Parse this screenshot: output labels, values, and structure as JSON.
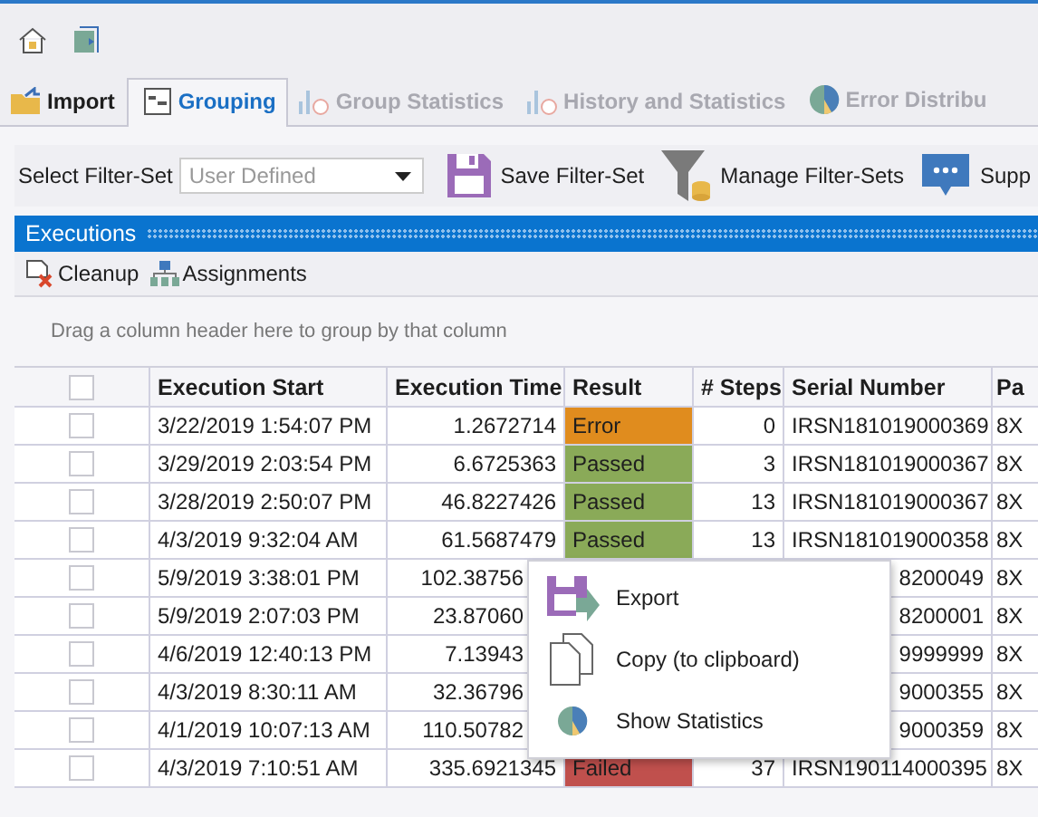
{
  "tabs": [
    {
      "label": "Import",
      "selected": false,
      "disabled": false
    },
    {
      "label": "Grouping",
      "selected": true,
      "disabled": false
    },
    {
      "label": "Group Statistics",
      "selected": false,
      "disabled": true
    },
    {
      "label": "History and Statistics",
      "selected": false,
      "disabled": true
    },
    {
      "label": "Error Distribu",
      "selected": false,
      "disabled": true
    }
  ],
  "filter_toolbar": {
    "label": "Select Filter-Set",
    "dropdown": {
      "placeholder": "User Defined"
    },
    "buttons": [
      "Save Filter-Set",
      "Manage Filter-Sets",
      "Supp"
    ]
  },
  "panel": {
    "title": "Executions",
    "actions": [
      "Cleanup",
      "Assignments"
    ],
    "group_hint": "Drag a column header here to group by that column"
  },
  "table": {
    "select_all_checked": false,
    "columns": [
      "Execution Start",
      "Execution Time",
      "Result",
      "# Steps",
      "Serial Number",
      "Pa"
    ],
    "rows": [
      {
        "checked": false,
        "start": "3/22/2019 1:54:07 PM",
        "time": "1.2672714",
        "result": "Error",
        "color": "#e08c1e",
        "steps": "0",
        "serial": "IRSN181019000369",
        "part": "8X"
      },
      {
        "checked": false,
        "start": "3/29/2019 2:03:54 PM",
        "time": "6.6725363",
        "result": "Passed",
        "color": "#8aaa58",
        "steps": "3",
        "serial": "IRSN181019000367",
        "part": "8X"
      },
      {
        "checked": false,
        "start": "3/28/2019 2:50:07 PM",
        "time": "46.8227426",
        "result": "Passed",
        "color": "#8aaa58",
        "steps": "13",
        "serial": "IRSN181019000367",
        "part": "8X"
      },
      {
        "checked": false,
        "start": "4/3/2019 9:32:04 AM",
        "time": "61.5687479",
        "result": "Passed",
        "color": "#8aaa58",
        "steps": "13",
        "serial": "IRSN181019000358",
        "part": "8X"
      },
      {
        "checked": false,
        "start": "5/9/2019 3:38:01 PM",
        "time": "102.38756",
        "serial": "8200049",
        "part": "8X"
      },
      {
        "checked": false,
        "start": "5/9/2019 2:07:03 PM",
        "time": "23.87060",
        "serial": "8200001",
        "part": "8X"
      },
      {
        "checked": false,
        "start": "4/6/2019 12:40:13 PM",
        "time": "7.13943",
        "serial": "9999999",
        "part": "8X"
      },
      {
        "checked": false,
        "start": "4/3/2019 8:30:11 AM",
        "time": "32.36796",
        "serial": "9000355",
        "part": "8X"
      },
      {
        "checked": false,
        "start": "4/1/2019 10:07:13 AM",
        "time": "110.50782",
        "serial": "9000359",
        "part": "8X"
      },
      {
        "checked": false,
        "start": "4/3/2019 7:10:51 AM",
        "time": "335.6921345",
        "result": "Failed",
        "color": "#c0504d",
        "steps": "37",
        "serial": "IRSN190114000395",
        "part": "8X"
      }
    ]
  },
  "context_menu": {
    "items": [
      "Export",
      "Copy (to clipboard)",
      "Show Statistics"
    ]
  }
}
